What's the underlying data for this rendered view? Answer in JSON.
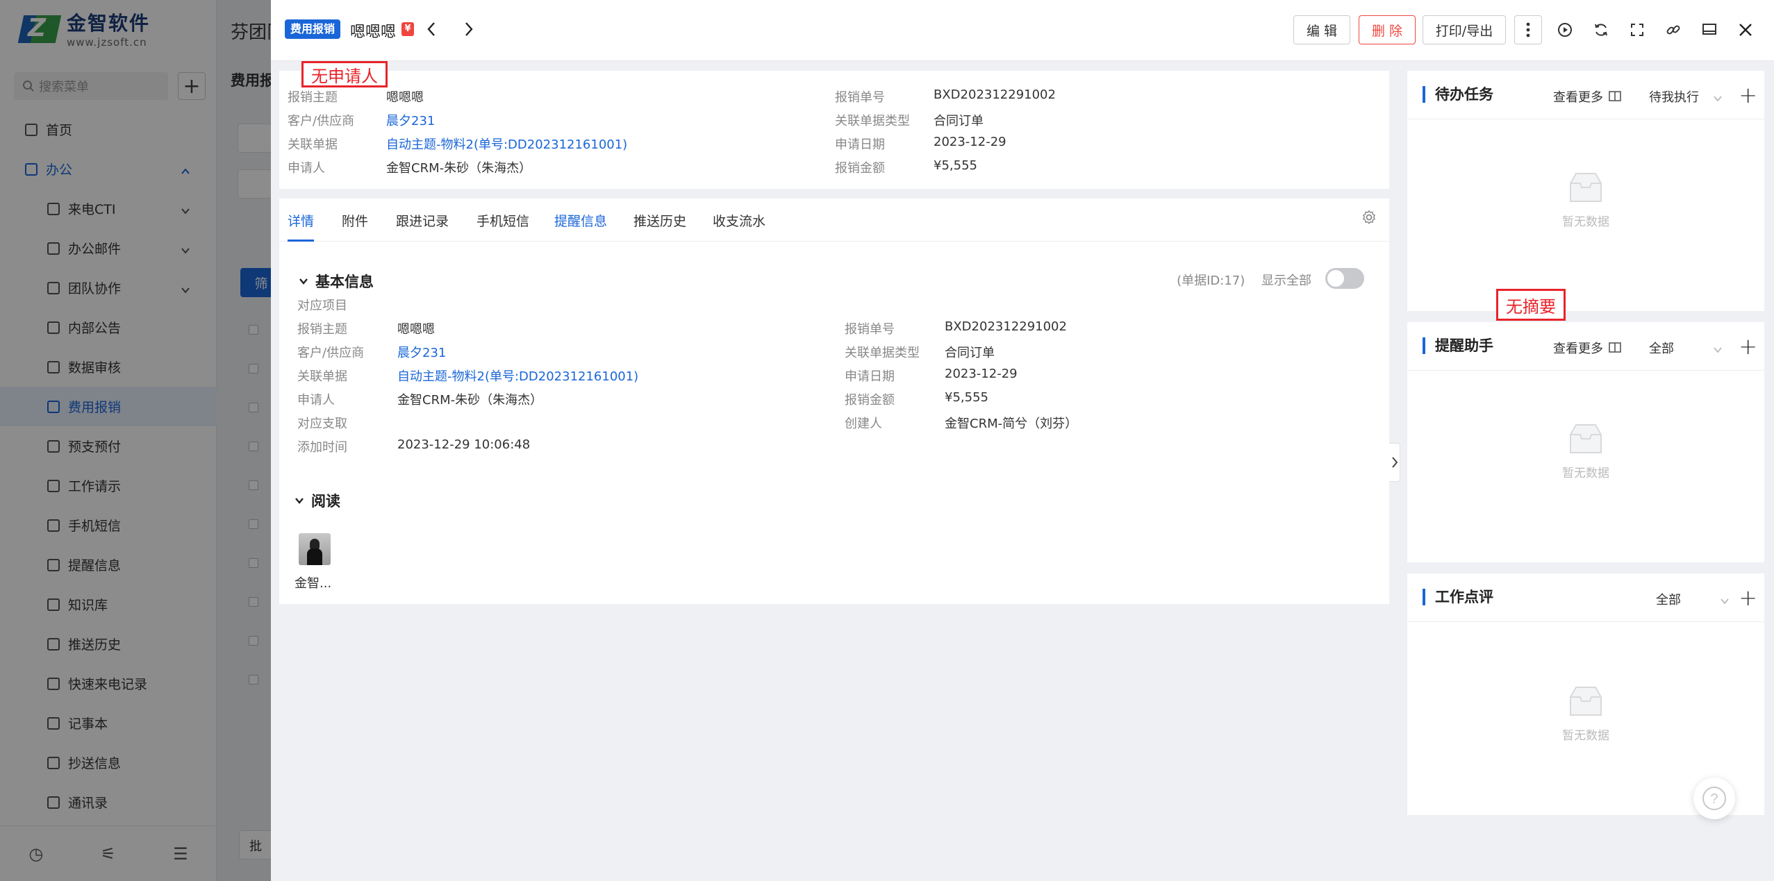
{
  "app": {
    "logo_title": "金智软件",
    "logo_url": "www.jzsoft.cn",
    "content_title": "芬团队",
    "subtab": "费用报",
    "filter_btn": "筛",
    "batch_btn": "批",
    "search_placeholder": "搜索菜单"
  },
  "sidebar": {
    "items": [
      {
        "label": "首页",
        "level": "top"
      },
      {
        "label": "办公",
        "level": "top",
        "open": true
      },
      {
        "label": "来电CTI",
        "level": "child",
        "expandable": true
      },
      {
        "label": "办公邮件",
        "level": "child",
        "expandable": true
      },
      {
        "label": "团队协作",
        "level": "child",
        "expandable": true
      },
      {
        "label": "内部公告",
        "level": "child"
      },
      {
        "label": "数据审核",
        "level": "child"
      },
      {
        "label": "费用报销",
        "level": "child",
        "active": true
      },
      {
        "label": "预支预付",
        "level": "child"
      },
      {
        "label": "工作请示",
        "level": "child"
      },
      {
        "label": "手机短信",
        "level": "child"
      },
      {
        "label": "提醒信息",
        "level": "child"
      },
      {
        "label": "知识库",
        "level": "child"
      },
      {
        "label": "推送历史",
        "level": "child"
      },
      {
        "label": "快速来电记录",
        "level": "child"
      },
      {
        "label": "记事本",
        "level": "child"
      },
      {
        "label": "抄送信息",
        "level": "child"
      },
      {
        "label": "通讯录",
        "level": "child"
      }
    ]
  },
  "drawer": {
    "tag": "费用报销",
    "title": "嗯嗯嗯",
    "money_mark": "¥",
    "buttons": {
      "edit": "编 辑",
      "delete": "删 除",
      "print": "打印/导出"
    },
    "annotations": {
      "no_applicant": "无申请人",
      "no_summary": "无摘要"
    }
  },
  "summary": {
    "left": [
      {
        "k": "报销主题",
        "v": "嗯嗯嗯"
      },
      {
        "k": "客户/供应商",
        "v": "晨夕231",
        "link": true
      },
      {
        "k": "关联单据",
        "v": "自动主题-物料2(单号:DD202312161001)",
        "link": true
      },
      {
        "k": "申请人",
        "v": "金智CRM-朱砂（朱海杰）"
      }
    ],
    "right": [
      {
        "k": "报销单号",
        "v": "BXD202312291002"
      },
      {
        "k": "关联单据类型",
        "v": "合同订单"
      },
      {
        "k": "申请日期",
        "v": "2023-12-29"
      },
      {
        "k": "报销金额",
        "v": "¥5,555"
      }
    ]
  },
  "tabs": [
    {
      "label": "详情",
      "state": "active"
    },
    {
      "label": "附件"
    },
    {
      "label": "跟进记录"
    },
    {
      "label": "手机短信"
    },
    {
      "label": "提醒信息",
      "state": "hl"
    },
    {
      "label": "推送历史"
    },
    {
      "label": "收支流水"
    }
  ],
  "basic": {
    "title": "基本信息",
    "doc_id": "(单据ID:17)",
    "show_all": "显示全部",
    "left": [
      {
        "k": "对应项目",
        "v": ""
      },
      {
        "k": "报销主题",
        "v": "嗯嗯嗯"
      },
      {
        "k": "客户/供应商",
        "v": "晨夕231",
        "link": true
      },
      {
        "k": "关联单据",
        "v": "自动主题-物料2(单号:DD202312161001)",
        "link": true
      },
      {
        "k": "申请人",
        "v": "金智CRM-朱砂（朱海杰）"
      },
      {
        "k": "对应支取",
        "v": ""
      },
      {
        "k": "添加时间",
        "v": "2023-12-29 10:06:48"
      }
    ],
    "right": [
      {
        "k": "报销单号",
        "v": "BXD202312291002"
      },
      {
        "k": "关联单据类型",
        "v": "合同订单"
      },
      {
        "k": "申请日期",
        "v": "2023-12-29"
      },
      {
        "k": "报销金额",
        "v": "¥5,555"
      },
      {
        "k": "创建人",
        "v": "金智CRM-简兮（刘芬）"
      }
    ]
  },
  "read": {
    "title": "阅读",
    "reader": "金智..."
  },
  "panels": [
    {
      "title": "待办任务",
      "more": "查看更多",
      "filter": "待我执行",
      "empty": "暂无数据"
    },
    {
      "title": "提醒助手",
      "more": "查看更多",
      "filter": "全部",
      "empty": "暂无数据"
    },
    {
      "title": "工作点评",
      "more": "",
      "filter": "全部",
      "empty": "暂无数据"
    }
  ]
}
